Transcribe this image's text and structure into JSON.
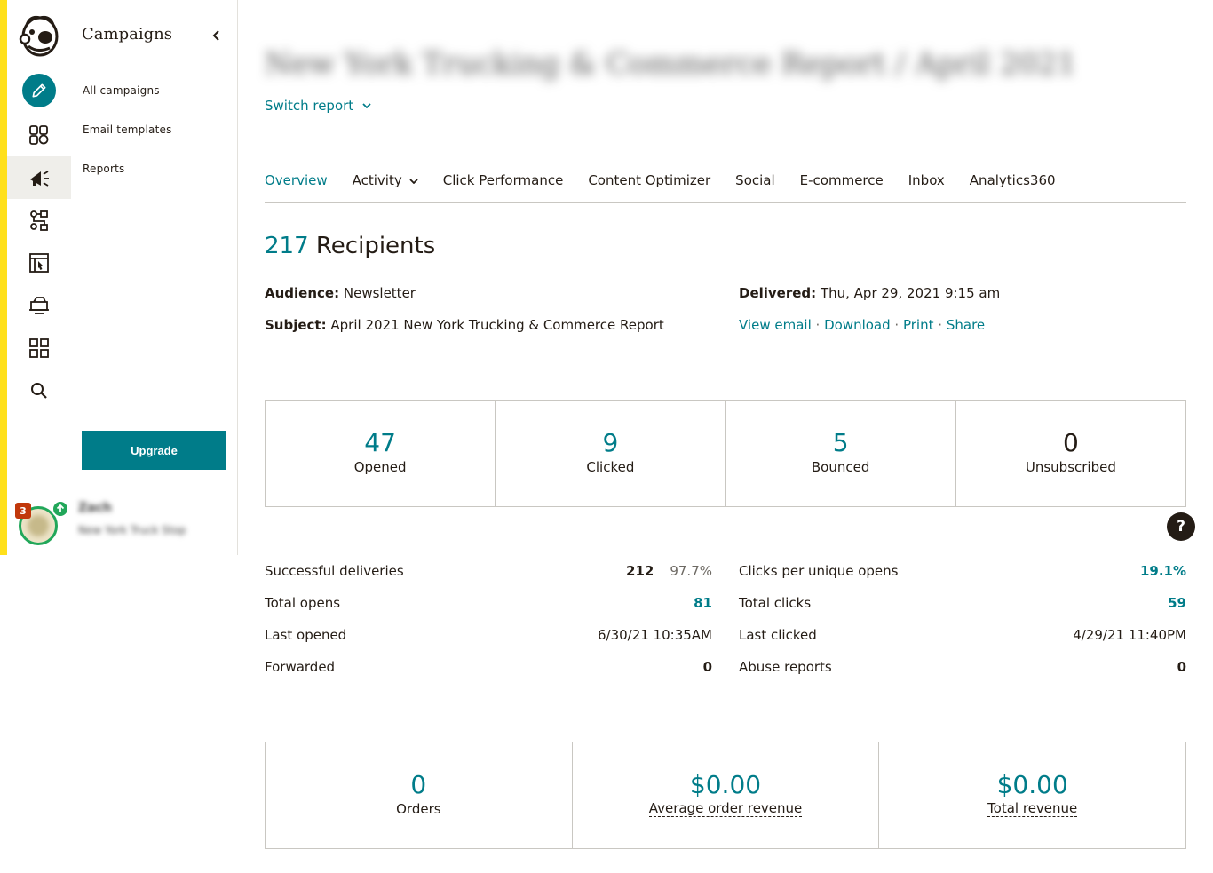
{
  "rail": {
    "notifications_count": "3",
    "icons": [
      "create-pencil-icon",
      "audience-icon",
      "campaigns-megaphone-icon",
      "automations-icon",
      "website-icon",
      "content-icon",
      "integrations-grid-icon",
      "search-icon"
    ]
  },
  "subnav": {
    "title": "Campaigns",
    "items": [
      "All campaigns",
      "Email templates",
      "Reports"
    ],
    "upgrade_label": "Upgrade",
    "account_name": "Zach",
    "account_org": "New York Truck Stop"
  },
  "report": {
    "title": "New York Trucking & Commerce Report / April 2021",
    "switch_label": "Switch report"
  },
  "tabs": [
    "Overview",
    "Activity",
    "Click Performance",
    "Content Optimizer",
    "Social",
    "E-commerce",
    "Inbox",
    "Analytics360"
  ],
  "summary": {
    "recipients_count": "217",
    "recipients_label": "Recipients",
    "audience_label": "Audience:",
    "audience_value": "Newsletter",
    "subject_label": "Subject:",
    "subject_value": "April 2021 New York Trucking & Commerce Report",
    "delivered_label": "Delivered:",
    "delivered_value": "Thu, Apr 29, 2021 9:15 am",
    "actions": [
      "View email",
      "Download",
      "Print",
      "Share"
    ],
    "separator": "·"
  },
  "stats": [
    {
      "value": "47",
      "label": "Opened"
    },
    {
      "value": "9",
      "label": "Clicked"
    },
    {
      "value": "5",
      "label": "Bounced"
    },
    {
      "value": "0",
      "label": "Unsubscribed"
    }
  ],
  "help_label": "?",
  "details_left": [
    {
      "key": "Successful deliveries",
      "value": "212",
      "pct": "97.7%"
    },
    {
      "key": "Total opens",
      "value": "81"
    },
    {
      "key": "Last opened",
      "value": "6/30/21 10:35AM"
    },
    {
      "key": "Forwarded",
      "value": "0"
    }
  ],
  "details_right": [
    {
      "key": "Clicks per unique opens",
      "value": "19.1%"
    },
    {
      "key": "Total clicks",
      "value": "59"
    },
    {
      "key": "Last clicked",
      "value": "4/29/21 11:40PM"
    },
    {
      "key": "Abuse reports",
      "value": "0"
    }
  ],
  "ecommerce": [
    {
      "value": "0",
      "label": "Orders"
    },
    {
      "value": "$0.00",
      "label": "Average order revenue"
    },
    {
      "value": "$0.00",
      "label": "Total revenue"
    }
  ],
  "colors": {
    "accent": "#007c89",
    "brand_yellow": "#ffe01b",
    "text": "#241c15",
    "success": "#22a75a",
    "alert": "#c1380b"
  }
}
